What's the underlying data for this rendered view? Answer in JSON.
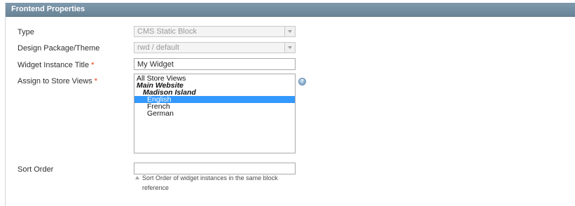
{
  "panel": {
    "title": "Frontend Properties"
  },
  "fields": {
    "type": {
      "label": "Type",
      "value": "CMS Static Block"
    },
    "design": {
      "label": "Design Package/Theme",
      "value": "rwd / default"
    },
    "title": {
      "label": "Widget Instance Title",
      "required_mark": "*",
      "value": "My Widget"
    },
    "store_views": {
      "label": "Assign to Store Views",
      "required_mark": "*",
      "options": [
        {
          "label": "All Store Views",
          "level": "top"
        },
        {
          "label": "Main Website",
          "level": "group"
        },
        {
          "label": "Madison Island",
          "level": "subgroup"
        },
        {
          "label": "English",
          "level": "leaf",
          "selected": true
        },
        {
          "label": "French",
          "level": "leaf"
        },
        {
          "label": "German",
          "level": "leaf"
        }
      ],
      "help_icon": "question-help-icon"
    },
    "sort_order": {
      "label": "Sort Order",
      "value": "",
      "note_line1": "Sort Order of widget instances in the same block",
      "note_line2": "reference"
    }
  },
  "colors": {
    "header_bg": "#7890a3",
    "required": "#eb340a",
    "selection": "#3399ff"
  }
}
